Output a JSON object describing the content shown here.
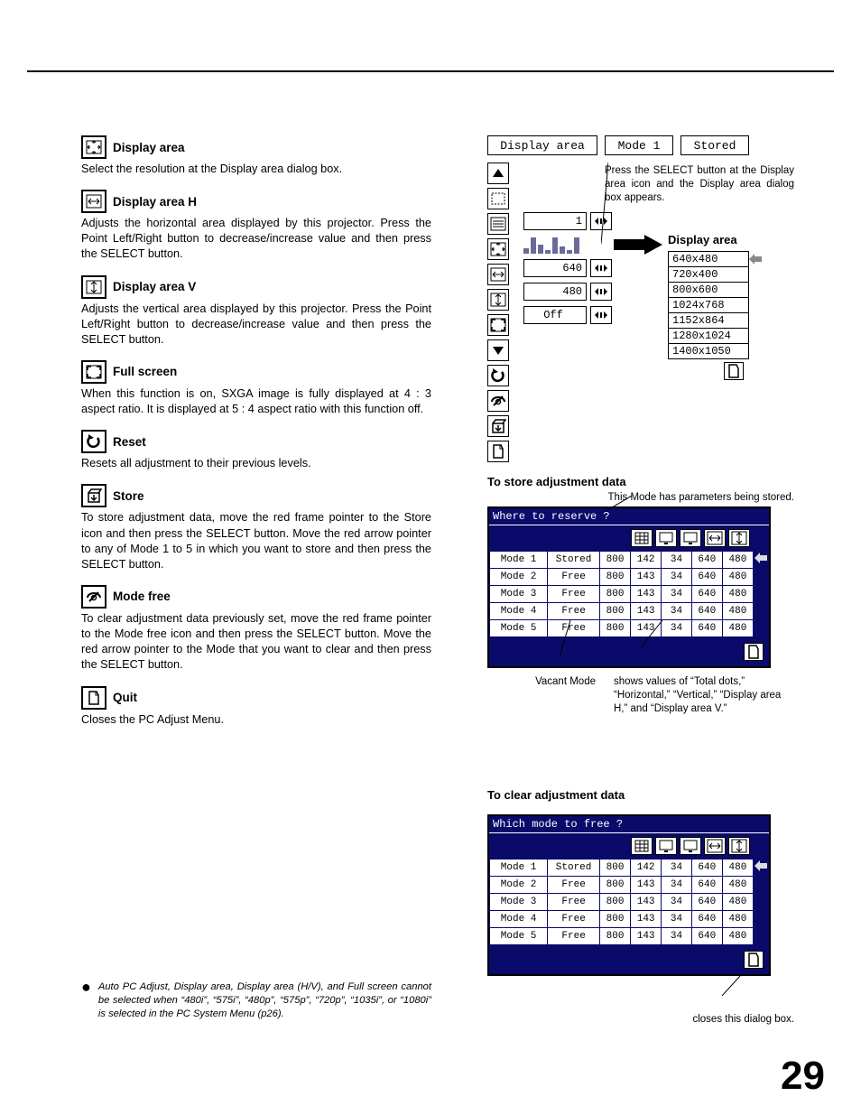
{
  "left_sections": [
    {
      "key": "display_area",
      "title": "Display area",
      "body": "Select the resolution at the Display area dialog box."
    },
    {
      "key": "display_area_h",
      "title": "Display area H",
      "body": "Adjusts the horizontal area displayed by this projector.  Press the Point Left/Right button to decrease/increase value and then press the SELECT button."
    },
    {
      "key": "display_area_v",
      "title": "Display area V",
      "body": "Adjusts the vertical area displayed by this projector.  Press the Point Left/Right button to decrease/increase value and then press the SELECT button."
    },
    {
      "key": "full_screen",
      "title": "Full screen",
      "body": "When this function is on, SXGA image is fully displayed at 4 : 3 aspect ratio.  It is displayed at 5 : 4 aspect ratio with this function off."
    },
    {
      "key": "reset",
      "title": "Reset",
      "body": "Resets all adjustment to their previous levels."
    },
    {
      "key": "store",
      "title": "Store",
      "body": "To store adjustment data, move the red frame pointer to the Store icon and then press the SELECT button.  Move the red arrow pointer to any of Mode 1 to 5 in which you want to store  and then press the SELECT button."
    },
    {
      "key": "mode_free",
      "title": "Mode free",
      "body": "To clear adjustment data previously set, move the red frame pointer to the Mode free icon and then press the SELECT button.  Move the red arrow pointer to the Mode that you want to clear and then press the SELECT button."
    },
    {
      "key": "quit",
      "title": "Quit",
      "body": "Closes the PC Adjust Menu."
    }
  ],
  "tabbar": {
    "main": "Display area",
    "mode": "Mode 1",
    "stored": "Stored"
  },
  "fig1": {
    "note": "Press the SELECT button at the Display area icon and the Display area dialog box appears.",
    "da_title": "Display area",
    "vals": {
      "line1": "1",
      "h": "640",
      "v": "480",
      "fs": "Off"
    },
    "resolutions": [
      "640x480",
      "720x400",
      "800x600",
      "1024x768",
      "1152x864",
      "1280x1024",
      "1400x1050"
    ]
  },
  "store_panel": {
    "title": "To store adjustment data",
    "sub": "This Mode has parameters being stored.",
    "head": "Where to reserve ?",
    "rows": [
      {
        "name": "Mode 1",
        "stat": "Stored",
        "a": "800",
        "b": "142",
        "c": "34",
        "d": "640",
        "e": "480",
        "sel": true
      },
      {
        "name": "Mode 2",
        "stat": "Free",
        "a": "800",
        "b": "143",
        "c": "34",
        "d": "640",
        "e": "480"
      },
      {
        "name": "Mode 3",
        "stat": "Free",
        "a": "800",
        "b": "143",
        "c": "34",
        "d": "640",
        "e": "480"
      },
      {
        "name": "Mode 4",
        "stat": "Free",
        "a": "800",
        "b": "143",
        "c": "34",
        "d": "640",
        "e": "480"
      },
      {
        "name": "Mode 5",
        "stat": "Free",
        "a": "800",
        "b": "143",
        "c": "34",
        "d": "640",
        "e": "480"
      }
    ],
    "callout_a": "Vacant Mode",
    "callout_b": "shows values of “Total dots,” “Horizontal,” “Vertical,” “Display area H,” and “Display area V.”"
  },
  "clear_panel": {
    "title": "To clear adjustment data",
    "head": "Which mode to free ?",
    "rows": [
      {
        "name": "Mode 1",
        "stat": "Stored",
        "a": "800",
        "b": "142",
        "c": "34",
        "d": "640",
        "e": "480",
        "sel": true
      },
      {
        "name": "Mode 2",
        "stat": "Free",
        "a": "800",
        "b": "143",
        "c": "34",
        "d": "640",
        "e": "480"
      },
      {
        "name": "Mode 3",
        "stat": "Free",
        "a": "800",
        "b": "143",
        "c": "34",
        "d": "640",
        "e": "480"
      },
      {
        "name": "Mode 4",
        "stat": "Free",
        "a": "800",
        "b": "143",
        "c": "34",
        "d": "640",
        "e": "480"
      },
      {
        "name": "Mode 5",
        "stat": "Free",
        "a": "800",
        "b": "143",
        "c": "34",
        "d": "640",
        "e": "480"
      }
    ],
    "close_note": "closes this dialog box."
  },
  "footnote": "Auto PC Adjust, Display area, Display area (H/V), and Full screen cannot be selected when “480i”, “575i”, “480p”, “575p”, “720p”, “1035i”, or “1080i” is selected in the PC System Menu (p26).",
  "page_number": "29",
  "icons": {
    "display_area": "display-area-icon",
    "display_area_h": "display-area-h-icon",
    "display_area_v": "display-area-v-icon",
    "full_screen": "full-screen-icon",
    "reset": "reset-icon",
    "store": "store-icon",
    "mode_free": "mode-free-icon",
    "quit": "quit-icon"
  }
}
